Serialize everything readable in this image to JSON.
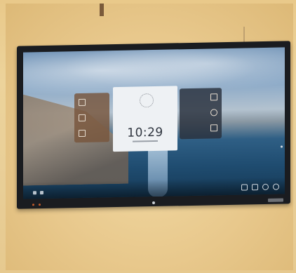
{
  "clock_widget": {
    "time": "10:29"
  },
  "icons": {
    "left_tile": [
      "pen-icon",
      "calendar-icon",
      "whiteboard-icon"
    ],
    "right_tile": [
      "chat-icon",
      "globe-icon",
      "grid-icon"
    ],
    "bottom_bar": [
      "window-icon",
      "screen-icon",
      "settings-icon",
      "power-icon"
    ]
  },
  "colors": {
    "wall": "#e9c98a",
    "bezel": "#1a1c20",
    "sea": "#1f4c70",
    "clock_bg": "#eef1f4"
  }
}
